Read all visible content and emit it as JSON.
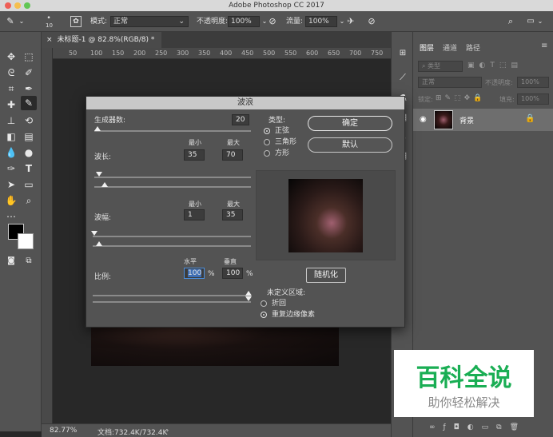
{
  "window": {
    "title": "Adobe Photoshop CC 2017"
  },
  "options_bar": {
    "brush_size": "10",
    "mode_label": "模式:",
    "mode_value": "正常",
    "opacity_label": "不透明度:",
    "opacity_value": "100%",
    "flow_label": "流量:",
    "flow_value": "100%"
  },
  "document": {
    "tab_title": "未标题-1 @ 82.8%(RGB/8) *",
    "ruler_ticks": [
      "50",
      "100",
      "150",
      "200",
      "250",
      "300",
      "350",
      "400",
      "450",
      "500",
      "550",
      "600",
      "650",
      "700",
      "750"
    ]
  },
  "status_bar": {
    "zoom": "82.77%",
    "doc_info": "文档:732.4K/732.4K"
  },
  "layers_panel": {
    "tabs": [
      "图层",
      "通道",
      "路径"
    ],
    "kind_filter": "类型",
    "blend_mode": "正常",
    "opacity_label": "不透明度:",
    "opacity_value": "100%",
    "lock_label": "锁定:",
    "fill_label": "填充:",
    "fill_value": "100%",
    "layer_name": "背景"
  },
  "dialog": {
    "title": "波浪",
    "generators_label": "生成器数:",
    "generators_value": "20",
    "wavelength_label": "波长:",
    "wavelength_min_label": "最小",
    "wavelength_max_label": "最大",
    "wavelength_min": "35",
    "wavelength_max": "70",
    "amplitude_label": "波幅:",
    "amplitude_min_label": "最小",
    "amplitude_max_label": "最大",
    "amplitude_min": "1",
    "amplitude_max": "35",
    "scale_label": "比例:",
    "scale_h_label": "水平",
    "scale_v_label": "垂直",
    "scale_h": "100",
    "scale_v": "100",
    "percent": "%",
    "type_label": "类型:",
    "type_options": [
      "正弦",
      "三角形",
      "方形"
    ],
    "type_selected": "正弦",
    "ok_label": "确定",
    "default_label": "默认",
    "randomize_label": "随机化",
    "undefined_label": "未定义区域:",
    "undefined_options": [
      "折回",
      "重复边缘像素"
    ],
    "undefined_selected": "重复边缘像素"
  },
  "watermark": {
    "main": "百科全说",
    "sub": "助你轻松解决"
  }
}
